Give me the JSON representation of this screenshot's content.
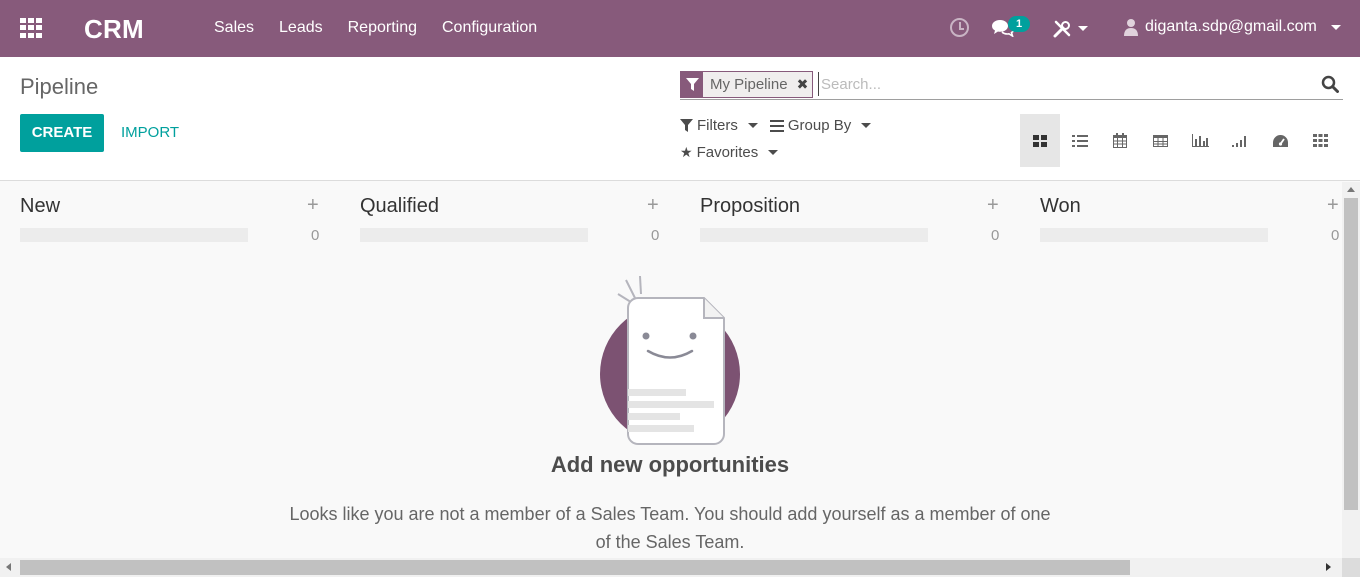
{
  "navbar": {
    "brand": "CRM",
    "menu": [
      "Sales",
      "Leads",
      "Reporting",
      "Configuration"
    ],
    "chat_badge": "1",
    "user_email": "diganta.sdp@gmail.com",
    "color": "#875a7b"
  },
  "control_panel": {
    "title": "Pipeline",
    "create_label": "CREATE",
    "import_label": "IMPORT",
    "search": {
      "facet": "My Pipeline",
      "placeholder": "Search..."
    },
    "filters_label": "Filters",
    "group_by_label": "Group By",
    "favorites_label": "Favorites",
    "views": [
      "kanban-icon",
      "list-icon",
      "calendar-icon",
      "pivot-icon",
      "graph-icon",
      "cohort-icon",
      "dashboard-icon",
      "grid-icon"
    ],
    "active_view": "kanban-icon"
  },
  "kanban": {
    "columns": [
      {
        "title": "New",
        "count": "0"
      },
      {
        "title": "Qualified",
        "count": "0"
      },
      {
        "title": "Proposition",
        "count": "0"
      },
      {
        "title": "Won",
        "count": "0"
      }
    ],
    "helper_title": "Add new opportunities",
    "helper_text": "Looks like you are not a member of a Sales Team. You should add yourself as a member of one of the Sales Team."
  },
  "accent_color": "#00a09d"
}
